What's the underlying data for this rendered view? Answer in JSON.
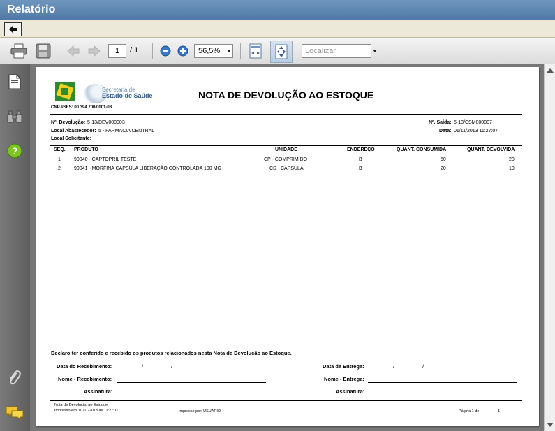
{
  "window": {
    "title": "Relatório"
  },
  "toolbar": {
    "page_current": "1",
    "page_total": "/ 1",
    "zoom": "56,5%",
    "find_placeholder": "Localizar"
  },
  "report": {
    "logo": {
      "line1": "Secretaria de",
      "line2": "Estado de Saúde"
    },
    "title": "NOTA DE DEVOLUÇÃO AO ESTOQUE",
    "cnpj": "CNPJ/SES: 00.394.700/0001-08",
    "devolucao_label": "Nº. Devolução:",
    "devolucao_value": "5-13/DEV000003",
    "saida_label": "Nº. Saída:",
    "saida_value": "5-13/CSM000007",
    "local_abast_label": "Local Abastecedor:",
    "local_abast_value": "5 - FARMACIA CENTRAL",
    "data_label": "Data:",
    "data_value": "01/11/2013 11:27:07",
    "local_solic_label": "Local Solicitante:",
    "columns": [
      "SEQ.",
      "PRODUTO",
      "UNIDADE",
      "ENDEREÇO",
      "QUANT. CONSUMIDA",
      "QUANT. DEVOLVIDA"
    ],
    "rows": [
      {
        "seq": "1",
        "produto": "90040 - CAPTOPRIL TESTE",
        "unidade": "CP - COMPRIMIDO",
        "endereco": "B",
        "consumida": "50",
        "devolvida": "20"
      },
      {
        "seq": "2",
        "produto": "90041 - MORFINA CAPSULA LIBERAÇÃO CONTROLADA 100 MG",
        "unidade": "CS - CAPSULA",
        "endereco": "B",
        "consumida": "20",
        "devolvida": "10"
      }
    ],
    "declaration": "Declaro ter conferido e recebido os produtos relacionados nesta Nota de Devolução ao Estoque.",
    "data_recebimento": "Data do Recebimento:",
    "nome_recebimento": "Nome - Recebimento:",
    "assinatura_left": "Assinatura:",
    "data_entrega": "Data da Entrega:",
    "nome_entrega": "Nome - Entrega:",
    "assinatura_right": "Assinatura:",
    "slash": "/",
    "footer_title": "Nota de Devolução ao Estoque",
    "footer_impresso_em": "Impresso em: 01/11/2013 às 11:27:11",
    "footer_impresso_por": "Impresso por: USUARIO",
    "footer_pagina": "Página 1 de",
    "footer_total": "1"
  }
}
